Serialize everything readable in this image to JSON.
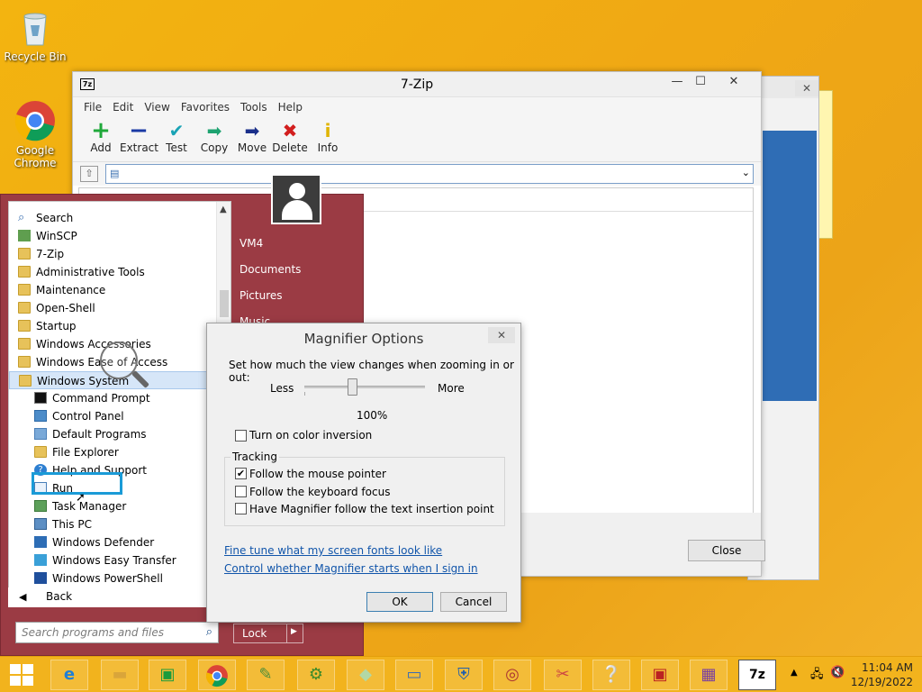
{
  "desktop": {
    "icons": [
      {
        "label": "Recycle Bin",
        "icon": "recycle-bin-icon"
      },
      {
        "label": "Google\nChrome",
        "icon": "chrome-icon"
      }
    ]
  },
  "zip_window": {
    "title": "7-Zip",
    "menu": [
      "File",
      "Edit",
      "View",
      "Favorites",
      "Tools",
      "Help"
    ],
    "toolbar": [
      {
        "label": "Add",
        "icon": "plus-icon",
        "color": "#1fa83a"
      },
      {
        "label": "Extract",
        "icon": "minus-icon",
        "color": "#1a3aa5"
      },
      {
        "label": "Test",
        "icon": "check-icon",
        "color": "#19a3b5"
      },
      {
        "label": "Copy",
        "icon": "copy-arrow-icon",
        "color": "#1ea371"
      },
      {
        "label": "Move",
        "icon": "move-arrow-icon",
        "color": "#1a2f8a"
      },
      {
        "label": "Delete",
        "icon": "delete-x-icon",
        "color": "#d21e1e"
      },
      {
        "label": "Info",
        "icon": "info-icon",
        "color": "#e0b400"
      }
    ],
    "status_close": "Close"
  },
  "start_menu": {
    "programs": [
      {
        "label": "Search",
        "icon": "search-icon",
        "level": 0
      },
      {
        "label": "WinSCP",
        "icon": "winscp-icon",
        "level": 0
      },
      {
        "label": "7-Zip",
        "icon": "folder-icon",
        "level": 0
      },
      {
        "label": "Administrative Tools",
        "icon": "folder-icon",
        "level": 0
      },
      {
        "label": "Maintenance",
        "icon": "folder-icon",
        "level": 0
      },
      {
        "label": "Open-Shell",
        "icon": "folder-icon",
        "level": 0
      },
      {
        "label": "Startup",
        "icon": "folder-icon",
        "level": 0
      },
      {
        "label": "Windows Accessories",
        "icon": "folder-icon",
        "level": 0
      },
      {
        "label": "Windows Ease of Access",
        "icon": "folder-icon",
        "level": 0
      },
      {
        "label": "Windows System",
        "icon": "folder-icon",
        "level": 0,
        "selected": true
      },
      {
        "label": "Command Prompt",
        "icon": "command-prompt-icon",
        "level": 1
      },
      {
        "label": "Control Panel",
        "icon": "control-panel-icon",
        "level": 1
      },
      {
        "label": "Default Programs",
        "icon": "default-programs-icon",
        "level": 1
      },
      {
        "label": "File Explorer",
        "icon": "file-explorer-icon",
        "level": 1
      },
      {
        "label": "Help and Support",
        "icon": "help-icon",
        "level": 1
      },
      {
        "label": "Run",
        "icon": "run-icon",
        "level": 1
      },
      {
        "label": "Task Manager",
        "icon": "task-manager-icon",
        "level": 1
      },
      {
        "label": "This PC",
        "icon": "this-pc-icon",
        "level": 1
      },
      {
        "label": "Windows Defender",
        "icon": "defender-icon",
        "level": 1
      },
      {
        "label": "Windows Easy Transfer",
        "icon": "easy-transfer-icon",
        "level": 1
      },
      {
        "label": "Windows PowerShell",
        "icon": "powershell-icon",
        "level": 1
      }
    ],
    "back_label": "Back",
    "search_placeholder": "Search programs and files",
    "right_items": [
      "VM4",
      "Documents",
      "Pictures",
      "Music"
    ],
    "lock_label": "Lock"
  },
  "magnifier": {
    "title": "Magnifier Options",
    "description": "Set how much the view changes when zooming in or out:",
    "less_label": "Less",
    "more_label": "More",
    "zoom_value": "100%",
    "color_inversion_label": "Turn on color inversion",
    "color_inversion_checked": false,
    "tracking_title": "Tracking",
    "tracking": [
      {
        "label": "Follow the mouse pointer",
        "checked": true
      },
      {
        "label": "Follow the keyboard focus",
        "checked": false
      },
      {
        "label": "Have Magnifier follow the text insertion point",
        "checked": false
      }
    ],
    "link_fonts": "Fine tune what my screen fonts look like",
    "link_startup": "Control whether Magnifier starts when I sign in",
    "ok_label": "OK",
    "cancel_label": "Cancel"
  },
  "taskbar": {
    "apps": [
      "ie-icon",
      "explorer-icon",
      "store-icon",
      "chrome-icon",
      "notepad-plus-icon",
      "winscp-icon",
      "folders-icon",
      "remote-desktop-icon",
      "defender-icon",
      "clock-app-icon",
      "snipping-icon",
      "help-icon",
      "media-icon",
      "installer-icon",
      "7zip-icon"
    ],
    "time": "11:04 AM",
    "date": "12/19/2022"
  }
}
